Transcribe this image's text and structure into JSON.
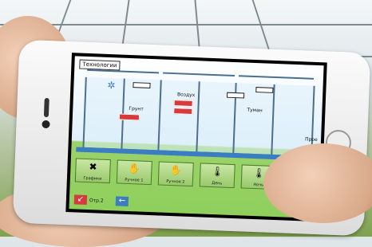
{
  "app": {
    "title": "Технологии",
    "labels": {
      "soil": "Грунт",
      "air": "Воздух",
      "heating": "Туман",
      "right_cut": "Прое"
    },
    "readings": {
      "soil": "",
      "air1": "",
      "air2": ""
    },
    "buttons": [
      {
        "name": "graphs",
        "label": "Графики",
        "icon": "✖"
      },
      {
        "name": "manual1",
        "label": "Ручное 1",
        "icon": "✋"
      },
      {
        "name": "manual2",
        "label": "Ручное 2",
        "icon": "✋"
      },
      {
        "name": "day",
        "label": "День",
        "icon": "🌡"
      },
      {
        "name": "night",
        "label": "Ночь",
        "icon": "🌡"
      }
    ],
    "nav": {
      "back_label": "Отр.2",
      "back_arrow": "↙",
      "left_arrow": "←",
      "right_arrow": "→"
    }
  }
}
